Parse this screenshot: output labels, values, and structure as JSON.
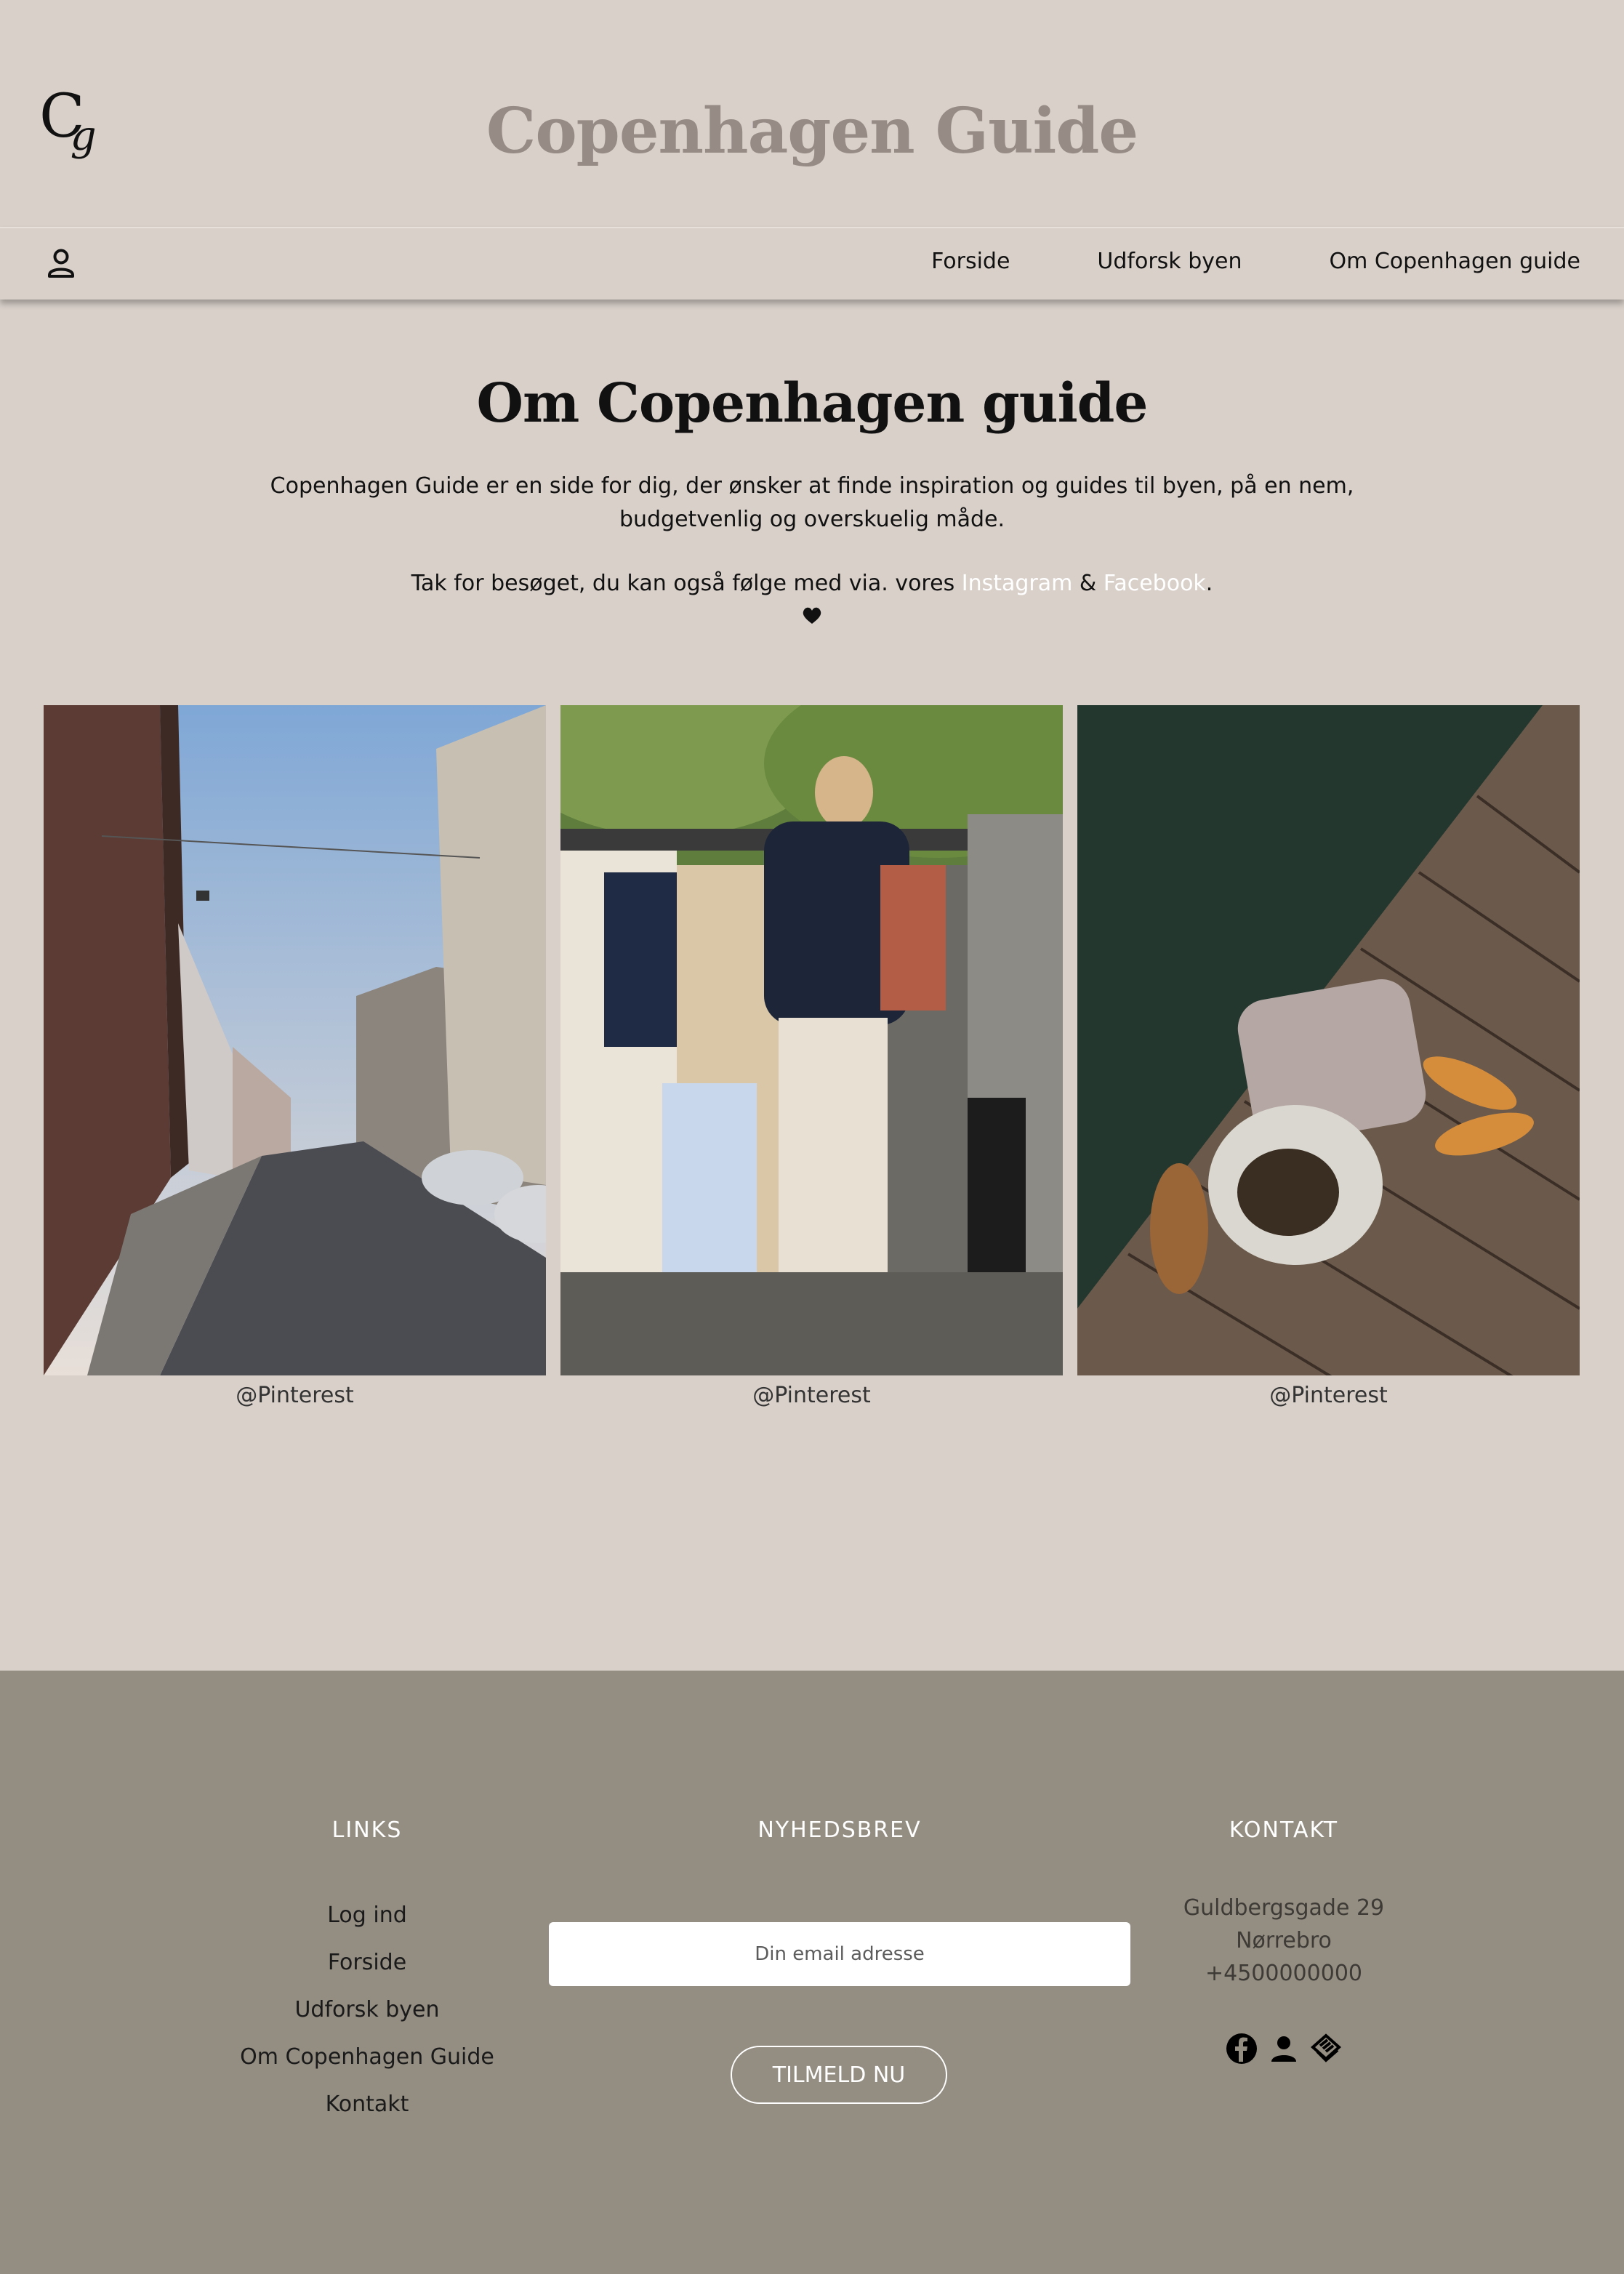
{
  "header": {
    "logo_text": "Cg",
    "site_title": "Copenhagen Guide"
  },
  "nav": {
    "items": [
      "Forside",
      "Udforsk byen",
      "Om Copenhagen guide"
    ]
  },
  "main": {
    "title": "Om Copenhagen guide",
    "intro": "Copenhagen Guide er en side for dig, der ønsker at finde inspiration og guides til byen, på en nem, budgetvenlig og overskuelig måde.",
    "thanks_prefix": "Tak for besøget, du kan også følge med via. vores ",
    "instagram_link": "Instagram",
    "amp": " & ",
    "facebook_link": "Facebook",
    "thanks_suffix": ".",
    "gallery": [
      {
        "caption": "@Pinterest",
        "scene": "street"
      },
      {
        "caption": "@Pinterest",
        "scene": "flea-market"
      },
      {
        "caption": "@Pinterest",
        "scene": "harbour-dock"
      }
    ]
  },
  "footer": {
    "links_heading": "LINKS",
    "links": [
      "Log ind",
      "Forside",
      "Udforsk byen",
      "Om Copenhagen Guide",
      "Kontakt"
    ],
    "newsletter_heading": "NYHEDSBREV",
    "email_placeholder": "Din email adresse",
    "submit_label": "TILMELD NU",
    "contact_heading": "KONTAKT",
    "address": "Guldbergsgade 29",
    "area": "Nørrebro",
    "phone": "+4500000000",
    "social_icons": [
      "facebook-icon",
      "user-icon",
      "layers-icon"
    ]
  },
  "colors": {
    "background": "#d9d0ca",
    "title_muted": "#978b86",
    "footer_bg": "#948d82",
    "link_accent": "#ffffff"
  }
}
